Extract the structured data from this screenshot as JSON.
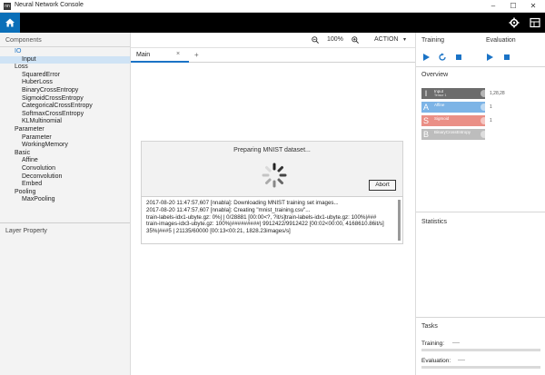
{
  "window": {
    "title": "Neural Network Console",
    "app_icon": "nn",
    "minimize": "–",
    "maximize": "☐",
    "close": "✕"
  },
  "topbar": {
    "home_icon": "home-icon",
    "settings_icon": "gear-icon",
    "layout_icon": "grid-icon",
    "accent_color": "#0b6fb8"
  },
  "components": {
    "header": "Components",
    "tree": [
      {
        "label": "IO",
        "level": "cat",
        "selected": true
      },
      {
        "label": "Input",
        "level": "sub",
        "highlight": true
      },
      {
        "label": "Loss",
        "level": "cat"
      },
      {
        "label": "SquaredError",
        "level": "sub"
      },
      {
        "label": "HuberLoss",
        "level": "sub"
      },
      {
        "label": "BinaryCrossEntropy",
        "level": "sub"
      },
      {
        "label": "SigmoidCrossEntropy",
        "level": "sub"
      },
      {
        "label": "CategoricalCrossEntropy",
        "level": "sub"
      },
      {
        "label": "SoftmaxCrossEntropy",
        "level": "sub"
      },
      {
        "label": "KLMultinomial",
        "level": "sub"
      },
      {
        "label": "Parameter",
        "level": "cat"
      },
      {
        "label": "Parameter",
        "level": "sub"
      },
      {
        "label": "WorkingMemory",
        "level": "sub"
      },
      {
        "label": "Basic",
        "level": "cat"
      },
      {
        "label": "Affine",
        "level": "sub"
      },
      {
        "label": "Convolution",
        "level": "sub"
      },
      {
        "label": "Deconvolution",
        "level": "sub"
      },
      {
        "label": "Embed",
        "level": "sub"
      },
      {
        "label": "Pooling",
        "level": "cat"
      },
      {
        "label": "MaxPooling",
        "level": "sub"
      }
    ],
    "layer_property": "Layer Property"
  },
  "editor": {
    "zoom": "100%",
    "action": "ACTION",
    "action_caret": "▾",
    "tab_main": "Main",
    "tab_close": "×",
    "tab_add": "+"
  },
  "dialog": {
    "title": "Preparing MNIST dataset...",
    "abort_label": "Abort"
  },
  "log": [
    "2017-08-20 11:47:57,607 [nnabla]: Downloading MNIST training set images...",
    "2017-08-20 11:47:57,607 [nnabla]: Creating \"mnist_training.csv\"...",
    "train-labels-idx1-ubyte.gz:  0%|        | 0/28881 [00:00<?, ?it/s]train-labels-idx1-ubyte.gz: 100%|###",
    "train-images-idx3-ubyte.gz: 100%|#########| 9912422/9912422 [00:02<00:00, 4168610.86it/s]",
    " 35%|###5      | 21135/60000 [00:13<00:21, 1828.23images/s]"
  ],
  "right_panel": {
    "training_label": "Training",
    "evaluation_label": "Evaluation",
    "overview_title": "Overview",
    "statistics_title": "Statistics",
    "tasks_title": "Tasks",
    "training_status_label": "Training:",
    "training_status_value": "----",
    "evaluation_status_label": "Evaluation:",
    "evaluation_status_value": "----",
    "overview_layers": [
      {
        "tag": "I",
        "label": "Input",
        "sub": "Tensor 1",
        "color": "#6c6c6c"
      },
      {
        "tag": "A",
        "label": "Affine",
        "sub": "",
        "color": "#7db4e6"
      },
      {
        "tag": "S",
        "label": "Sigmoid",
        "sub": "",
        "color": "#ea8f86"
      },
      {
        "tag": "B",
        "label": "BinaryCrossEntropy",
        "sub": "",
        "color": "#bdbdbd"
      }
    ],
    "overview_shapes": [
      "1,28,28",
      "1",
      "1",
      ""
    ]
  }
}
